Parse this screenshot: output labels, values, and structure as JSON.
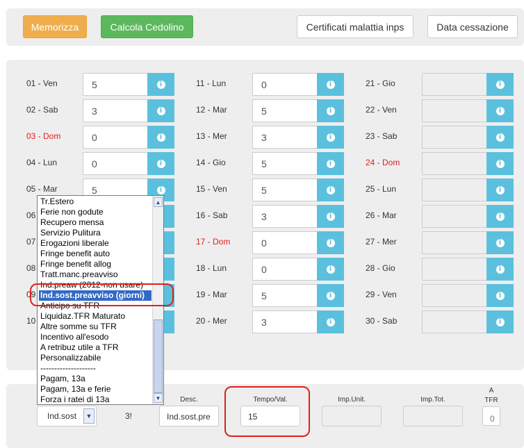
{
  "toolbar": {
    "save_label": "Memorizza",
    "calc_label": "Calcola Cedolino",
    "certificates_label": "Certificati malattia inps",
    "end_date_label": "Data cessazione"
  },
  "days": {
    "d01": {
      "label": "01 - Ven",
      "value": "5"
    },
    "d02": {
      "label": "02 - Sab",
      "value": "3"
    },
    "d03": {
      "label": "03 - Dom",
      "value": "0"
    },
    "d04": {
      "label": "04 - Lun",
      "value": "0"
    },
    "d05": {
      "label": "05 - Mar",
      "value": "5"
    },
    "d06": {
      "label": "06"
    },
    "d07": {
      "label": "07"
    },
    "d08": {
      "label": "08"
    },
    "d09": {
      "label": "09"
    },
    "d10": {
      "label": "10"
    },
    "d11": {
      "label": "11 - Lun",
      "value": "0"
    },
    "d12": {
      "label": "12 - Mar",
      "value": "5"
    },
    "d13": {
      "label": "13 - Mer",
      "value": "3"
    },
    "d14": {
      "label": "14 - Gio",
      "value": "5"
    },
    "d15": {
      "label": "15 - Ven",
      "value": "5"
    },
    "d16": {
      "label": "16 - Sab",
      "value": "3"
    },
    "d17": {
      "label": "17 - Dom",
      "value": "0"
    },
    "d18": {
      "label": "18 - Lun",
      "value": "0"
    },
    "d19": {
      "label": "19 - Mar",
      "value": "5"
    },
    "d20": {
      "label": "20 - Mer",
      "value": "3"
    },
    "d21": {
      "label": "21 - Gio",
      "value": ""
    },
    "d22": {
      "label": "22 - Ven",
      "value": ""
    },
    "d23": {
      "label": "23 - Sab",
      "value": ""
    },
    "d24": {
      "label": "24 - Dom",
      "value": ""
    },
    "d25": {
      "label": "25 - Lun",
      "value": ""
    },
    "d26": {
      "label": "26 - Mar",
      "value": ""
    },
    "d27": {
      "label": "27 - Mer",
      "value": ""
    },
    "d28": {
      "label": "28 - Gio",
      "value": ""
    },
    "d29": {
      "label": "29 - Ven",
      "value": ""
    },
    "d30": {
      "label": "30 - Sab",
      "value": ""
    }
  },
  "info_icon_glyph": "i",
  "dropdown_options": [
    "Tr.Estero",
    "Ferie non godute",
    "Recupero mensa",
    "Servizio Pulitura",
    "Erogazioni liberale",
    "Fringe benefit auto",
    "Fringe benefit allog",
    "Tratt.manc.preavviso",
    "Ind.preaw (2012-non usare)",
    "Ind.sost.preavviso (giorni)",
    "Anticipo su TFR",
    "Liquidaz.TFR Maturato",
    "Altre somme su TFR",
    "Incentivo all'esodo",
    "A retribuz utile a TFR",
    "Personalizzabile",
    "--------------------",
    "Pagam, 13a",
    "Pagam, 13a e ferie",
    "Forza i ratei di 13a"
  ],
  "selected_option": "Ind.sost.preavviso (giorni)",
  "bottom": {
    "select_value": "Ind.sost",
    "code_value": "3!",
    "desc_label": "Desc.",
    "desc_value": "Ind.sost.pre",
    "time_label": "Tempo/Val.",
    "time_value": "15",
    "unit_label": "Imp.Unit.",
    "total_label": "Imp.Tot.",
    "tfr_label_a": "A",
    "tfr_label_b": "TFR",
    "tfr_value": "0"
  },
  "colors": {
    "accent_orange": "#f0ad4e",
    "accent_green": "#5cb85c",
    "info_blue": "#5bc0de",
    "sunday_red": "#e0201b",
    "highlight_ring": "#e0201b",
    "selection_blue": "#3169c6"
  }
}
